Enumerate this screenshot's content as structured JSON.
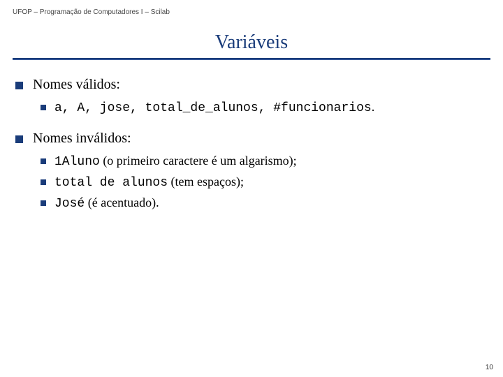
{
  "header": "UFOP – Programação de Computadores I – Scilab",
  "title": "Variáveis",
  "valid": {
    "heading": "Nomes válidos:",
    "items": [
      {
        "code": "a, A, jose, total_de_alunos, #funcionarios",
        "rest": "."
      }
    ]
  },
  "invalid": {
    "heading": "Nomes inválidos:",
    "items": [
      {
        "code": "1Aluno",
        "rest": " (o primeiro caractere é um algarismo);"
      },
      {
        "code": "total de alunos",
        "rest": " (tem espaços);"
      },
      {
        "code": "José",
        "rest": " (é acentuado)."
      }
    ]
  },
  "page_number": "10"
}
